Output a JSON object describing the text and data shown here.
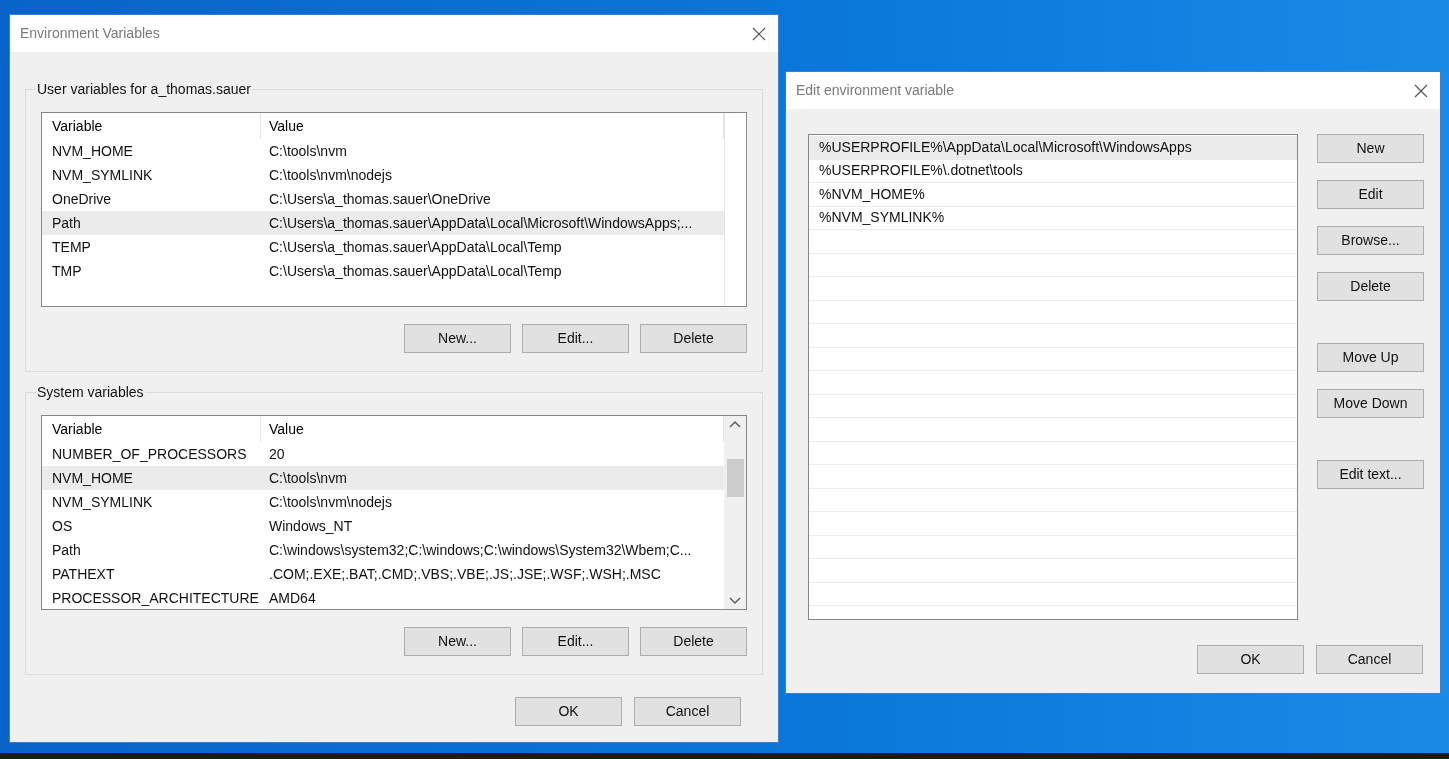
{
  "main_window": {
    "title": "Environment Variables",
    "user_group": {
      "title": "User variables for a_thomas.sauer",
      "columns": [
        "Variable",
        "Value"
      ],
      "rows": [
        {
          "variable": "NVM_HOME",
          "value": "C:\\tools\\nvm",
          "selected": false
        },
        {
          "variable": "NVM_SYMLINK",
          "value": "C:\\tools\\nvm\\nodejs",
          "selected": false
        },
        {
          "variable": "OneDrive",
          "value": "C:\\Users\\a_thomas.sauer\\OneDrive",
          "selected": false
        },
        {
          "variable": "Path",
          "value": "C:\\Users\\a_thomas.sauer\\AppData\\Local\\Microsoft\\WindowsApps;...",
          "selected": true
        },
        {
          "variable": "TEMP",
          "value": "C:\\Users\\a_thomas.sauer\\AppData\\Local\\Temp",
          "selected": false
        },
        {
          "variable": "TMP",
          "value": "C:\\Users\\a_thomas.sauer\\AppData\\Local\\Temp",
          "selected": false
        }
      ],
      "buttons": [
        "New...",
        "Edit...",
        "Delete"
      ]
    },
    "system_group": {
      "title": "System variables",
      "columns": [
        "Variable",
        "Value"
      ],
      "rows": [
        {
          "variable": "NUMBER_OF_PROCESSORS",
          "value": "20",
          "selected": false
        },
        {
          "variable": "NVM_HOME",
          "value": "C:\\tools\\nvm",
          "selected": true
        },
        {
          "variable": "NVM_SYMLINK",
          "value": "C:\\tools\\nvm\\nodejs",
          "selected": false
        },
        {
          "variable": "OS",
          "value": "Windows_NT",
          "selected": false
        },
        {
          "variable": "Path",
          "value": "C:\\windows\\system32;C:\\windows;C:\\windows\\System32\\Wbem;C...",
          "selected": false
        },
        {
          "variable": "PATHEXT",
          "value": ".COM;.EXE;.BAT;.CMD;.VBS;.VBE;.JS;.JSE;.WSF;.WSH;.MSC",
          "selected": false
        },
        {
          "variable": "PROCESSOR_ARCHITECTURE",
          "value": "AMD64",
          "selected": false
        }
      ],
      "buttons": [
        "New...",
        "Edit...",
        "Delete"
      ]
    },
    "buttons": [
      "OK",
      "Cancel"
    ]
  },
  "edit_window": {
    "title": "Edit environment variable",
    "entries": [
      {
        "text": "%USERPROFILE%\\AppData\\Local\\Microsoft\\WindowsApps",
        "selected": true
      },
      {
        "text": "%USERPROFILE%\\.dotnet\\tools",
        "selected": false
      },
      {
        "text": "%NVM_HOME%",
        "selected": false
      },
      {
        "text": "%NVM_SYMLINK%",
        "selected": false
      }
    ],
    "side_button_groups": [
      [
        "New",
        "Edit",
        "Browse...",
        "Delete"
      ],
      [
        "Move Up",
        "Move Down"
      ],
      [
        "Edit text..."
      ]
    ],
    "buttons": [
      "OK",
      "Cancel"
    ]
  }
}
